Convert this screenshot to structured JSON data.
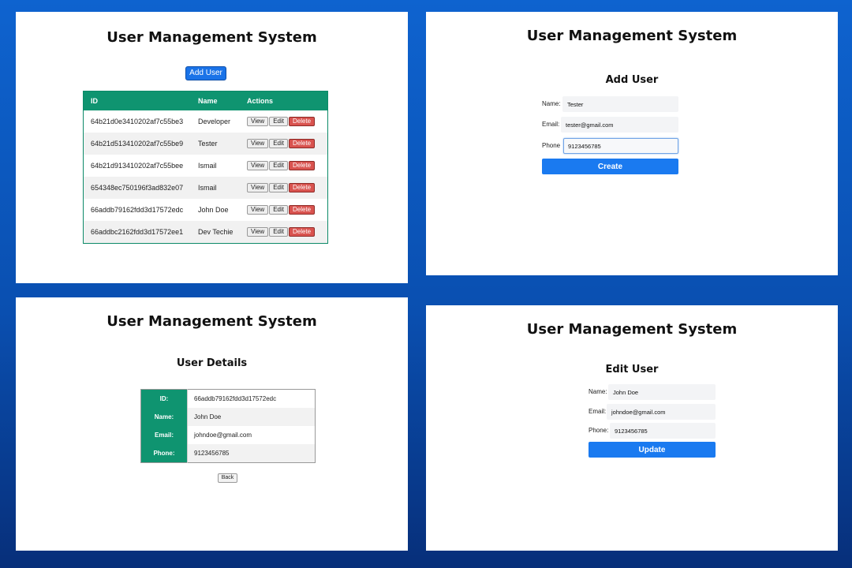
{
  "list_view": {
    "title": "User Management System",
    "add_user_label": "Add User",
    "columns": [
      "ID",
      "Name",
      "Actions"
    ],
    "action_labels": {
      "view": "View",
      "edit": "Edit",
      "delete": "Delete"
    },
    "rows": [
      {
        "id": "64b21d0e3410202af7c55be3",
        "name": "Developer"
      },
      {
        "id": "64b21d513410202af7c55be9",
        "name": "Tester"
      },
      {
        "id": "64b21d913410202af7c55bee",
        "name": "Ismail"
      },
      {
        "id": "654348ec750196f3ad832e07",
        "name": "Ismail"
      },
      {
        "id": "66addb79162fdd3d17572edc",
        "name": "John Doe"
      },
      {
        "id": "66addbc2162fdd3d17572ee1",
        "name": "Dev Techie"
      }
    ]
  },
  "add_view": {
    "title": "User Management System",
    "heading": "Add User",
    "name_label": "Name:",
    "name_value": "Tester",
    "email_label": "Email:",
    "email_value": "tester@gmail.com",
    "phone_label": "Phone",
    "phone_value": "9123456785",
    "submit_label": "Create"
  },
  "details_view": {
    "title": "User Management System",
    "heading": "User Details",
    "fields": [
      {
        "label": "ID:",
        "value": "66addb79162fdd3d17572edc"
      },
      {
        "label": "Name:",
        "value": "John Doe"
      },
      {
        "label": "Email:",
        "value": "johndoe@gmail.com"
      },
      {
        "label": "Phone:",
        "value": "9123456785"
      }
    ],
    "back_label": "Back"
  },
  "edit_view": {
    "title": "User Management System",
    "heading": "Edit User",
    "name_label": "Name:",
    "name_value": "John Doe",
    "email_label": "Email:",
    "email_value": "johndoe@gmail.com",
    "phone_label": "Phone:",
    "phone_value": "9123456785",
    "submit_label": "Update"
  },
  "colors": {
    "background": "#0a4fb0",
    "table_header": "#0f9470",
    "primary": "#1a7af0",
    "delete": "#d9534f"
  }
}
